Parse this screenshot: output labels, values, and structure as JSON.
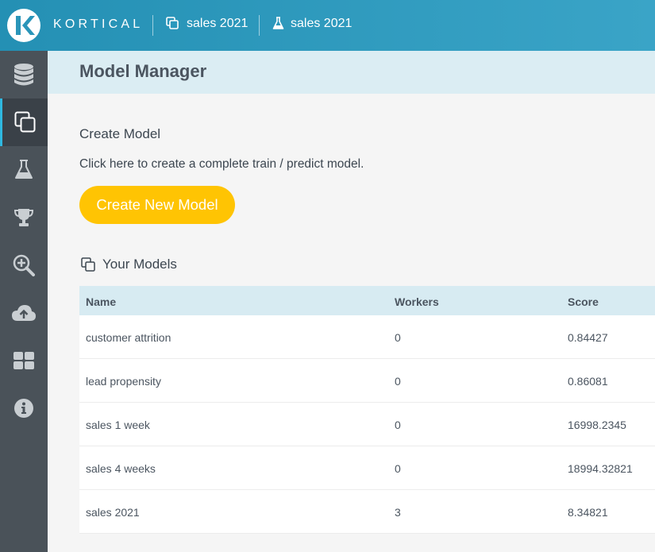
{
  "app": {
    "brand": "KORTICAL",
    "breadcrumbs": [
      {
        "label": "sales 2021",
        "icon": "copy-icon"
      },
      {
        "label": "sales 2021",
        "icon": "flask-icon"
      }
    ]
  },
  "sidebar": {
    "items": [
      {
        "name": "data",
        "icon": "database-icon",
        "active": false
      },
      {
        "name": "models",
        "icon": "copy-icon",
        "active": true
      },
      {
        "name": "experiments",
        "icon": "flask-icon",
        "active": false
      },
      {
        "name": "leaderboard",
        "icon": "trophy-icon",
        "active": false
      },
      {
        "name": "explain",
        "icon": "zoom-in-icon",
        "active": false
      },
      {
        "name": "deploy",
        "icon": "cloud-upload-icon",
        "active": false
      },
      {
        "name": "apps",
        "icon": "grid-icon",
        "active": false
      },
      {
        "name": "info",
        "icon": "info-icon",
        "active": false
      }
    ],
    "active_color": "#2fb8e0"
  },
  "page": {
    "title": "Model Manager",
    "create": {
      "heading": "Create Model",
      "description": "Click here to create a complete train / predict model.",
      "button_label": "Create New Model",
      "button_color": "#ffc403"
    },
    "models": {
      "heading": "Your Models",
      "columns": [
        "Name",
        "Workers",
        "Score"
      ],
      "rows": [
        [
          "customer attrition",
          "0",
          "0.84427"
        ],
        [
          "lead propensity",
          "0",
          "0.86081"
        ],
        [
          "sales 1 week",
          "0",
          "16998.2345"
        ],
        [
          "sales 4 weeks",
          "0",
          "18994.32821"
        ],
        [
          "sales 2021",
          "3",
          "8.34821"
        ]
      ]
    }
  }
}
